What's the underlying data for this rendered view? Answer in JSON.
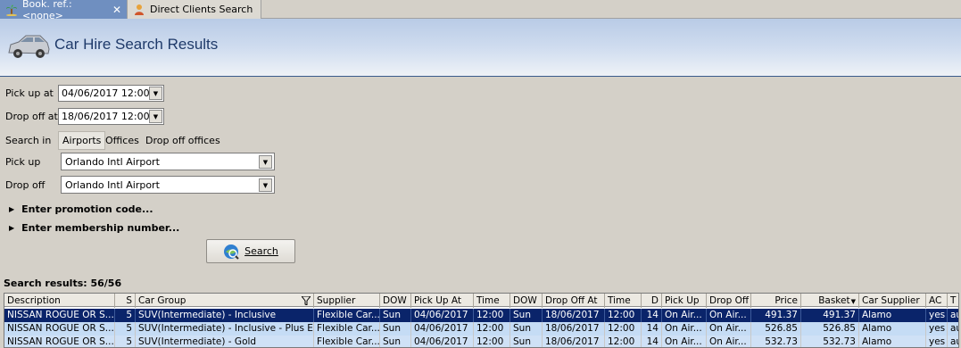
{
  "tabs": [
    {
      "label": "Book. ref.: <none>",
      "icon": "palm-tree-icon"
    },
    {
      "label": "Direct Clients Search",
      "icon": "clients-search-icon"
    }
  ],
  "header": {
    "title": "Car Hire Search Results"
  },
  "form": {
    "pickup_at_label": "Pick up at",
    "pickup_at_value": "04/06/2017 12:00",
    "dropoff_at_label": "Drop off at",
    "dropoff_at_value": "18/06/2017 12:00",
    "search_in_label": "Search in",
    "search_in_options": [
      "Airports",
      "Offices",
      "Drop off offices"
    ],
    "pickup_label": "Pick up",
    "pickup_value": "Orlando Intl Airport",
    "dropoff_label": "Drop off",
    "dropoff_value": "Orlando Intl Airport",
    "promo_label": "Enter promotion code...",
    "membership_label": "Enter membership number...",
    "search_button": "Search"
  },
  "results": {
    "label": "Search results: 56/56",
    "columns": [
      "Description",
      "S",
      "Car Group",
      "Supplier",
      "DOW",
      "Pick Up At",
      "Time",
      "DOW",
      "Drop Off At",
      "Time",
      "D",
      "Pick Up",
      "Drop Off",
      "Price",
      "Basket",
      "Car Supplier",
      "AC",
      "T"
    ],
    "rows": [
      [
        "NISSAN ROGUE OR S...",
        "5",
        "SUV(Intermediate) - Inclusive",
        "Flexible Car...",
        "Sun",
        "04/06/2017",
        "12:00",
        "Sun",
        "18/06/2017",
        "12:00",
        "14",
        "On Air...",
        "On Air...",
        "491.37",
        "491.37",
        "Alamo",
        "yes",
        "au"
      ],
      [
        "NISSAN ROGUE OR S...",
        "5",
        "SUV(Intermediate) - Inclusive - Plus E...",
        "Flexible Car...",
        "Sun",
        "04/06/2017",
        "12:00",
        "Sun",
        "18/06/2017",
        "12:00",
        "14",
        "On Air...",
        "On Air...",
        "526.85",
        "526.85",
        "Alamo",
        "yes",
        "au"
      ],
      [
        "NISSAN ROGUE OR S...",
        "5",
        "SUV(Intermediate) - Gold",
        "Flexible Car...",
        "Sun",
        "04/06/2017",
        "12:00",
        "Sun",
        "18/06/2017",
        "12:00",
        "14",
        "On Air...",
        "On Air...",
        "532.73",
        "532.73",
        "Alamo",
        "yes",
        "au"
      ]
    ]
  }
}
